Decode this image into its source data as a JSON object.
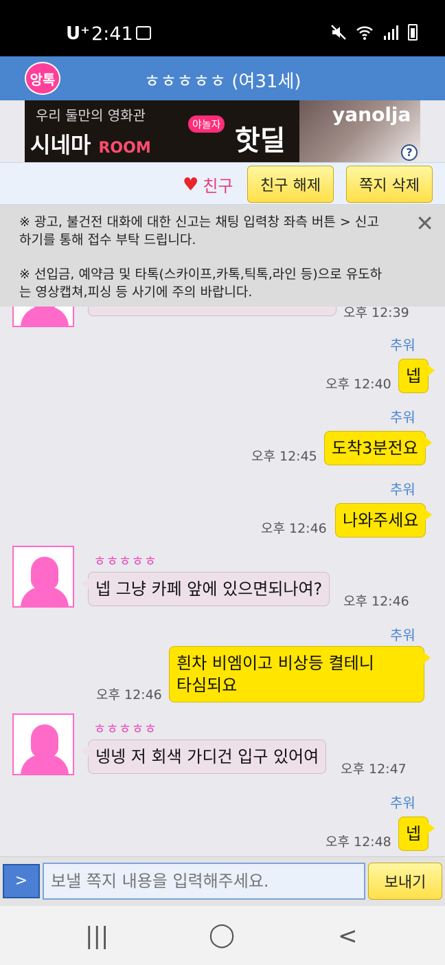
{
  "status_bar": {
    "carrier": "U⁺",
    "time": "2:41"
  },
  "header": {
    "logo_text": "앙톡",
    "title": "ㅎㅎㅎㅎㅎ (여31세)"
  },
  "banner": {
    "line1": "우리 둘만의 영화관",
    "line2_main": "시네마",
    "line2_room": "ROOM",
    "badge": "야놀자",
    "hot": "핫딜",
    "brand": "yanolja",
    "help": "?"
  },
  "action_bar": {
    "friend_label": "친구",
    "unfriend_label": "친구 해제",
    "delete_label": "쪽지 삭제"
  },
  "notice": {
    "line1": "※ 광고, 불건전 대화에 대한 신고는 채팅 입력창 좌측 버튼 > 신고하기를 통해 접수 부탁 드립니다.",
    "line2": "※ 선입금, 예약금 및 타톡(스카이프,카톡,틱톡,라인 등)으로 유도하는 영상캡쳐,피싱 등 사기에 주의 바랍니다."
  },
  "chat": {
    "partial_time": "오후 12:39",
    "messages": [
      {
        "sender": "추워",
        "text": "넵",
        "time": "오후 12:40"
      },
      {
        "sender": "추워",
        "text": "도착3분전요",
        "time": "오후 12:45"
      },
      {
        "sender": "추워",
        "text": "나와주세요",
        "time": "오후 12:46"
      },
      {
        "sender": "ㅎㅎㅎㅎㅎ",
        "text": "넵 그냥 카페 앞에 있으면되나여?",
        "time": "오후 12:46"
      },
      {
        "sender": "추워",
        "text_line1": "흰차 비엠이고 비상등 켤테니",
        "text_line2": "타심되요",
        "time": "오후 12:46"
      },
      {
        "sender": "ㅎㅎㅎㅎㅎ",
        "text": "넹넹 저 회색 가디건 입구 있어여",
        "time": "오후 12:47"
      },
      {
        "sender": "추워",
        "text": "넵",
        "time": "오후 12:48"
      }
    ]
  },
  "input_bar": {
    "menu_label": ">",
    "placeholder": "보낼 쪽지 내용을 입력해주세요.",
    "send_label": "보내기"
  },
  "nav": {
    "recents": "|||",
    "home": "◯",
    "back": "<"
  }
}
